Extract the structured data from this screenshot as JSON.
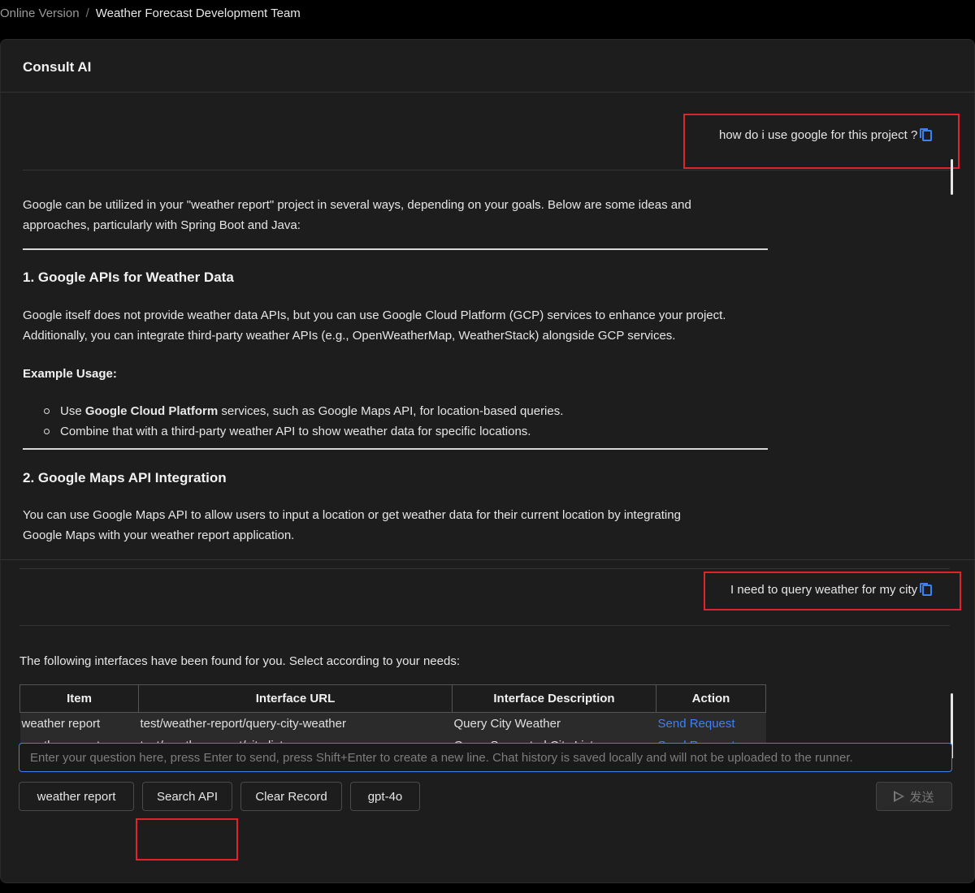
{
  "breadcrumb": {
    "root": "Online Version",
    "separator": "/",
    "current": "Weather Forecast Development Team"
  },
  "panel": {
    "title": "Consult AI"
  },
  "messages": {
    "user1": "how do i use google for this project ?",
    "ai_intro_1": "Google can be utilized in your \"weather report\" project in several ways, depending on your goals. Below are some ideas and",
    "ai_intro_2": "approaches, particularly with Spring Boot and Java:",
    "h1": "1. Google APIs for Weather Data",
    "p1_1": "Google itself does not provide weather data APIs, but you can use Google Cloud Platform (GCP) services to enhance your project.",
    "p1_2": "Additionally, you can integrate third-party weather APIs (e.g., OpenWeatherMap, WeatherStack) alongside GCP services.",
    "example_label": "Example Usage:",
    "list": [
      {
        "pre": "Use ",
        "bold": "Google Cloud Platform",
        "post": " services, such as Google Maps API, for location-based queries."
      },
      {
        "pre": "Combine that with a third-party weather API to show weather data for specific locations.",
        "bold": "",
        "post": ""
      }
    ],
    "h2": "2. Google Maps API Integration",
    "p2_1": "You can use Google Maps API to allow users to input a location or get weather data for their current location by integrating",
    "p2_2": "Google Maps with your weather report application.",
    "user2": "I need to query weather for my city",
    "ai_found": "The following interfaces have been found for you. Select according to your needs:"
  },
  "table": {
    "headers": [
      "Item",
      "Interface URL",
      "Interface Description",
      "Action"
    ],
    "rows": [
      [
        "weather report",
        "test/weather-report/query-city-weather",
        "Query City Weather",
        "Send Request"
      ],
      [
        "weather report",
        "test/weather-report/city-list",
        "Query Supported City List",
        "Send Request"
      ]
    ]
  },
  "input": {
    "placeholder": "Enter your question here, press Enter to send, press Shift+Enter to create a new line. Chat history is saved locally and will not be uploaded to the runner."
  },
  "buttons": {
    "weather_report": "weather report",
    "search_api": "Search API",
    "clear_record": "Clear Record",
    "model": "gpt-4o",
    "send": "发送"
  },
  "colors": {
    "accent": "#3b82f6",
    "highlight": "#e0242e",
    "panel_bg": "#1d1d1e"
  }
}
